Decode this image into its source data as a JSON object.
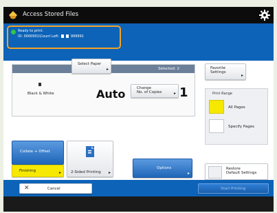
{
  "window": {
    "title": "Access Stored Files"
  },
  "status": {
    "line1": "Ready to print.",
    "line2_prefix": "ID: 0000001\\Count Left:",
    "line2_count": "999991"
  },
  "settings": {
    "selected_label": "Selected: 2",
    "color_mode": "Black & White",
    "paper": "Auto",
    "copies": "1"
  },
  "buttons": {
    "select_paper": "Select Paper",
    "change_copies_line1": "Change",
    "change_copies_line2": "No. of Copies",
    "collate": "Collate + Offset",
    "finishing": "Finishing",
    "two_sided": "2-Sided Printing",
    "options": "Options",
    "favorite_line1": "Favorite",
    "favorite_line2": "Settings",
    "restore_line1": "Restore",
    "restore_line2": "Default Settings",
    "cancel": "Cancel",
    "start": "Start Printing"
  },
  "print_range": {
    "header": "Print Range",
    "all_pages": "All Pages",
    "specify_pages": "Specify Pages"
  },
  "colors": {
    "accent_blue": "#0d63b8",
    "highlight_orange": "#f3a323",
    "selected_yellow": "#f6e800"
  }
}
